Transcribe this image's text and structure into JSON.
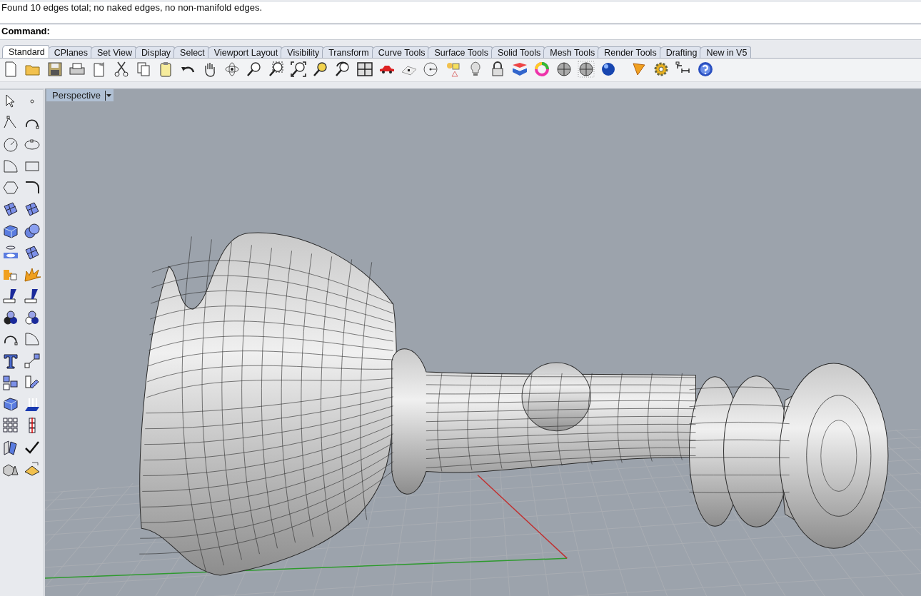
{
  "command_history": {
    "text": "Found 10 edges total; no naked edges, no non-manifold edges."
  },
  "command_line": {
    "prompt": "Command:"
  },
  "tabs": [
    {
      "label": "Standard",
      "selected": true
    },
    {
      "label": "CPlanes",
      "selected": false
    },
    {
      "label": "Set View",
      "selected": false
    },
    {
      "label": "Display",
      "selected": false
    },
    {
      "label": "Select",
      "selected": false
    },
    {
      "label": "Viewport Layout",
      "selected": false
    },
    {
      "label": "Visibility",
      "selected": false
    },
    {
      "label": "Transform",
      "selected": false
    },
    {
      "label": "Curve Tools",
      "selected": false
    },
    {
      "label": "Surface Tools",
      "selected": false
    },
    {
      "label": "Solid Tools",
      "selected": false
    },
    {
      "label": "Mesh Tools",
      "selected": false
    },
    {
      "label": "Render Tools",
      "selected": false
    },
    {
      "label": "Drafting",
      "selected": false
    },
    {
      "label": "New in V5",
      "selected": false
    }
  ],
  "viewport": {
    "title": "Perspective"
  }
}
